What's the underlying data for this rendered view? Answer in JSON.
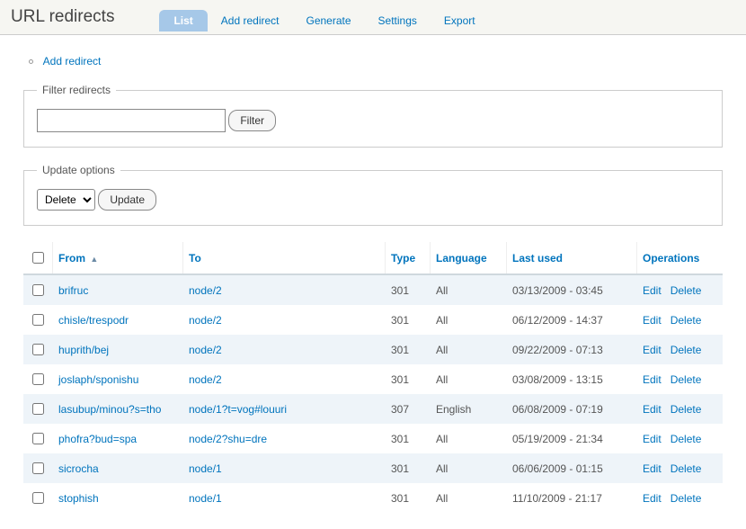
{
  "header": {
    "title": "URL redirects",
    "tabs": [
      {
        "label": "List",
        "active": true
      },
      {
        "label": "Add redirect",
        "active": false
      },
      {
        "label": "Generate",
        "active": false
      },
      {
        "label": "Settings",
        "active": false
      },
      {
        "label": "Export",
        "active": false
      }
    ]
  },
  "action_link": {
    "label": "Add redirect"
  },
  "filter": {
    "legend": "Filter redirects",
    "value": "",
    "button": "Filter"
  },
  "update": {
    "legend": "Update options",
    "selected": "Delete",
    "button": "Update"
  },
  "table": {
    "columns": {
      "from": "From",
      "to": "To",
      "type": "Type",
      "language": "Language",
      "last_used": "Last used",
      "operations": "Operations"
    },
    "op_labels": {
      "edit": "Edit",
      "delete": "Delete"
    },
    "rows": [
      {
        "from": "brifruc",
        "to": "node/2",
        "type": "301",
        "language": "All",
        "last_used": "03/13/2009 - 03:45"
      },
      {
        "from": "chisle/trespodr",
        "to": "node/2",
        "type": "301",
        "language": "All",
        "last_used": "06/12/2009 - 14:37"
      },
      {
        "from": "huprith/bej",
        "to": "node/2",
        "type": "301",
        "language": "All",
        "last_used": "09/22/2009 - 07:13"
      },
      {
        "from": "joslaph/sponishu",
        "to": "node/2",
        "type": "301",
        "language": "All",
        "last_used": "03/08/2009 - 13:15"
      },
      {
        "from": "lasubup/minou?s=tho",
        "to": "node/1?t=vog#louuri",
        "type": "307",
        "language": "English",
        "last_used": "06/08/2009 - 07:19"
      },
      {
        "from": "phofra?bud=spa",
        "to": "node/2?shu=dre",
        "type": "301",
        "language": "All",
        "last_used": "05/19/2009 - 21:34"
      },
      {
        "from": "sicrocha",
        "to": "node/1",
        "type": "301",
        "language": "All",
        "last_used": "06/06/2009 - 01:15"
      },
      {
        "from": "stophish",
        "to": "node/1",
        "type": "301",
        "language": "All",
        "last_used": "11/10/2009 - 21:17"
      }
    ]
  }
}
